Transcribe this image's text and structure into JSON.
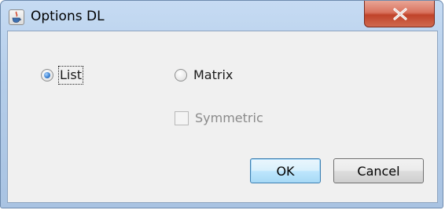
{
  "window": {
    "title": "Options DL",
    "app_icon": "java-cup-icon",
    "close_icon": "close-icon"
  },
  "options": {
    "radio_list_label": "List",
    "radio_list_checked": true,
    "radio_matrix_label": "Matrix",
    "radio_matrix_checked": false,
    "checkbox_symmetric_label": "Symmetric",
    "checkbox_symmetric_checked": false,
    "checkbox_symmetric_enabled": false
  },
  "buttons": {
    "ok_label": "OK",
    "cancel_label": "Cancel"
  },
  "colors": {
    "close_button": "#c0432a",
    "default_button_border": "#3c7fb1",
    "disabled_text": "#8a8a8a"
  }
}
